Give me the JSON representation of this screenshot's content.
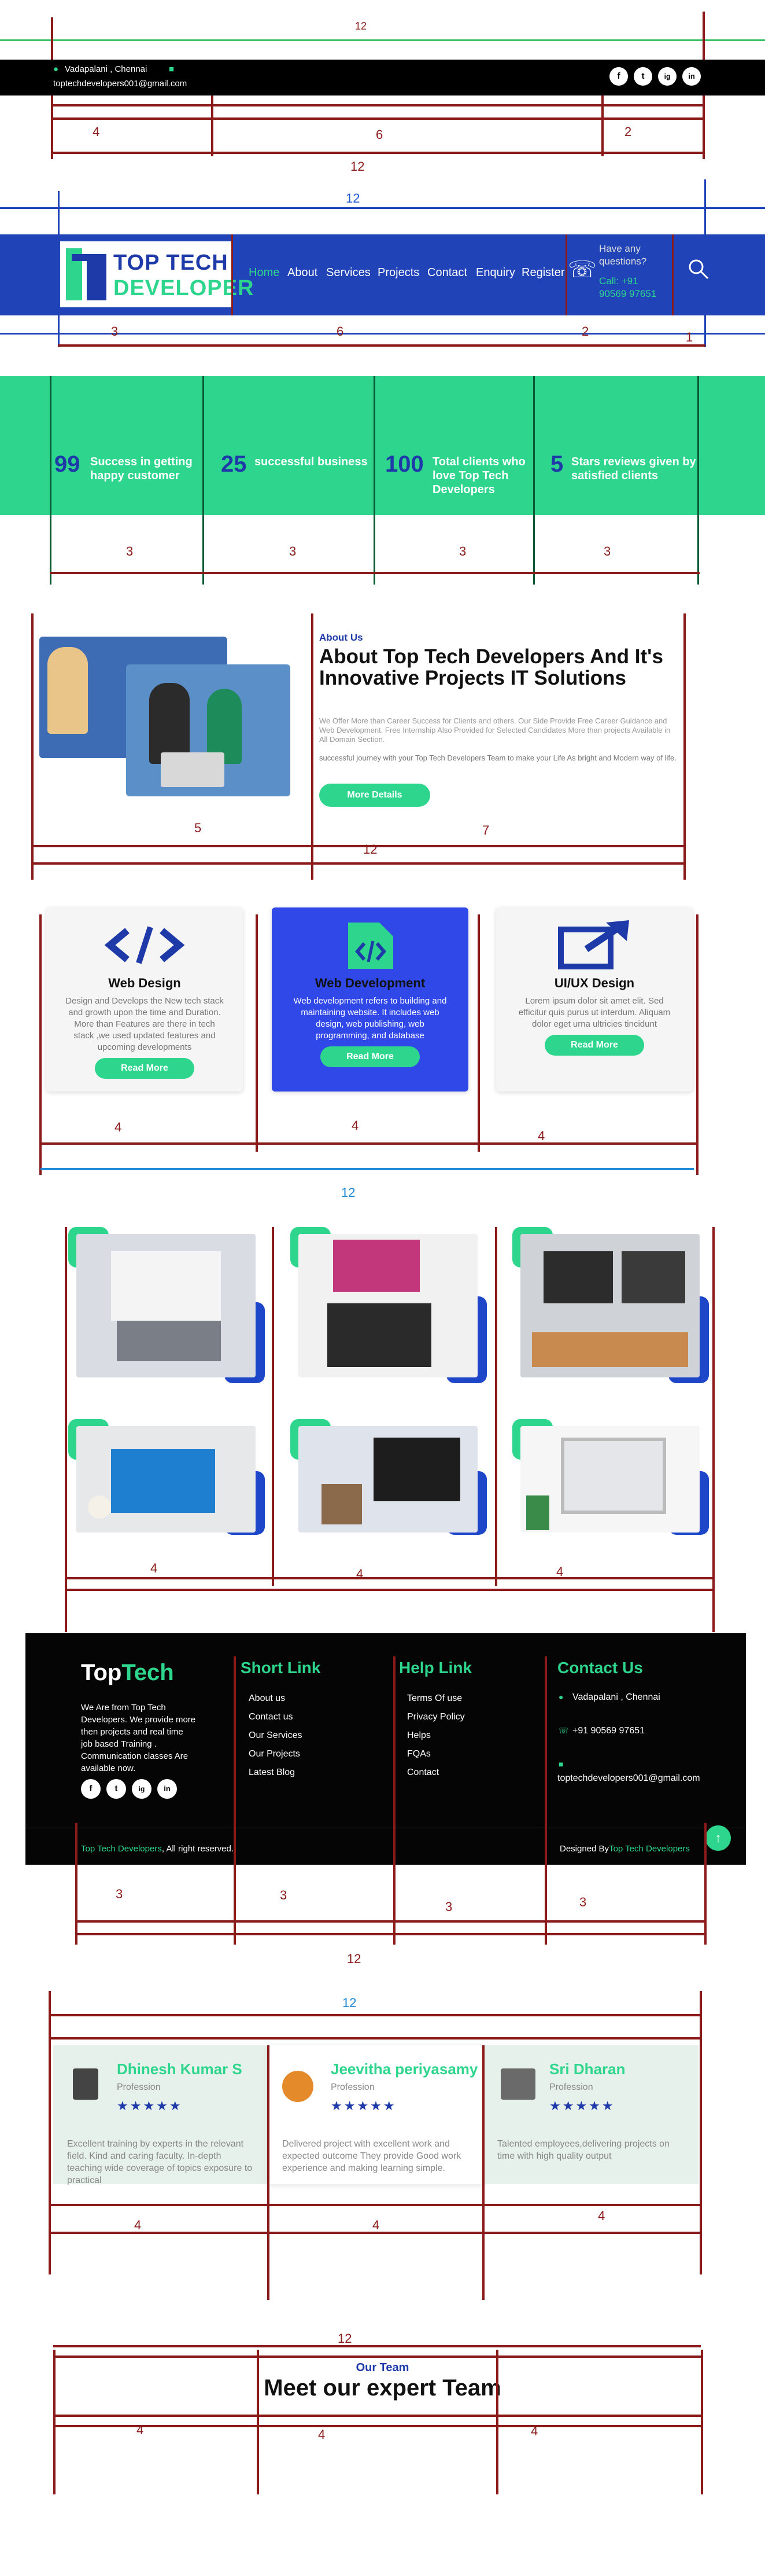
{
  "annotations": {
    "grid_total": "12",
    "topbar_cols": [
      "4",
      "6",
      "2"
    ],
    "header_cols": [
      "3",
      "6",
      "2",
      "1"
    ],
    "stats_cols": [
      "3",
      "3",
      "3",
      "3"
    ],
    "about_cols": [
      "5",
      "7"
    ],
    "services_cols": [
      "4",
      "4",
      "4"
    ],
    "gallery_cols": [
      "4",
      "4",
      "4"
    ],
    "footer_cols": [
      "3",
      "3",
      "3",
      "3"
    ],
    "testimonial_cols": [
      "4",
      "4",
      "4"
    ],
    "team_cols": [
      "4",
      "4",
      "4"
    ]
  },
  "topbar": {
    "location": "Vadapalani , Chennai",
    "email": "toptechdevelopers001@gmail.com",
    "social": [
      "f",
      "t",
      "ig",
      "in"
    ]
  },
  "header": {
    "logo_line1": "TOP TECH",
    "logo_line2": "DEVELOPER",
    "nav": [
      "Home",
      "About",
      "Services",
      "Projects",
      "Contact",
      "Enquiry",
      "Register"
    ],
    "cta_question": "Have any questions?",
    "cta_call": "Call: +91 90569 97651",
    "accent": "#2ed68d",
    "primary": "#2044b8"
  },
  "stats": [
    {
      "number": "99",
      "label": "Success in getting happy customer"
    },
    {
      "number": "25",
      "label": "successful business"
    },
    {
      "number": "100",
      "label": "Total clients who love Top Tech Developers"
    },
    {
      "number": "5",
      "label": "Stars reviews given by satisfied clients"
    }
  ],
  "about": {
    "kicker": "About Us",
    "title": "About Top Tech Developers And It's Innovative Projects IT Solutions",
    "para1": "We Offer More than Career Success for Clients and others. Our Side Provide Free Career Guidance and Web Development. Free Internship Also Provided for Selected Candidates More than projects Available in All Domain Section.",
    "para2": "successful journey with your Top Tech Developers Team to make your Life As bright and Modern way of life.",
    "button": "More Details"
  },
  "services": [
    {
      "title": "Web Design",
      "desc": "Design and Develops the New tech stack and growth upon the time and Duration. More than Features are there in tech stack ,we used updated features and upcoming developments",
      "button": "Read More",
      "icon": "code-icon"
    },
    {
      "title": "Web Development",
      "desc": "Web development refers to building and maintaining website. It includes web design, web publishing, web programming, and database",
      "button": "Read More",
      "icon": "code-file-icon"
    },
    {
      "title": "UI/UX Design",
      "desc": "Lorem ipsum dolor sit amet elit. Sed efficitur quis purus ut interdum. Aliquam dolor eget urna ultricies tincidunt",
      "button": "Read More",
      "icon": "share-arrow-icon"
    }
  ],
  "footer": {
    "brand1": "Top",
    "brand2": "Tech",
    "about": "We Are from Top Tech Developers. We provide more then projects and real time job based Training . Communication classes Are available now.",
    "short_link_title": "Short Link",
    "short_links": [
      "About us",
      "Contact us",
      "Our Services",
      "Our Projects",
      "Latest Blog"
    ],
    "help_link_title": "Help Link",
    "help_links": [
      "Terms Of use",
      "Privacy Policy",
      "Helps",
      "FQAs",
      "Contact"
    ],
    "contact_title": "Contact Us",
    "contact_location": "Vadapalani , Chennai",
    "contact_phone": "+91 90569 97651",
    "contact_email": "toptechdevelopers001@gmail.com",
    "copyright_brand": "Top Tech Developers",
    "copyright_rest": ", All right reserved.",
    "designed_by": "Designed By",
    "designed_brand": "Top Tech Developers"
  },
  "testimonials": [
    {
      "name": "Dhinesh Kumar S",
      "profession": "Profession",
      "stars": "★★★★★",
      "text": "Excellent training by experts in the relevant field. Kind and caring faculty. In-depth teaching wide coverage of topics exposure to practical"
    },
    {
      "name": "Jeevitha periyasamy",
      "profession": "Profession",
      "stars": "★★★★★",
      "text": "Delivered project with excellent work and expected outcome They provide Good work experience and making learning simple."
    },
    {
      "name": "Sri Dharan",
      "profession": "Profession",
      "stars": "★★★★★",
      "text": "Talented employees,delivering projects on time with high quality output"
    }
  ],
  "team": {
    "kicker": "Our Team",
    "title": "Meet our expert Team"
  }
}
